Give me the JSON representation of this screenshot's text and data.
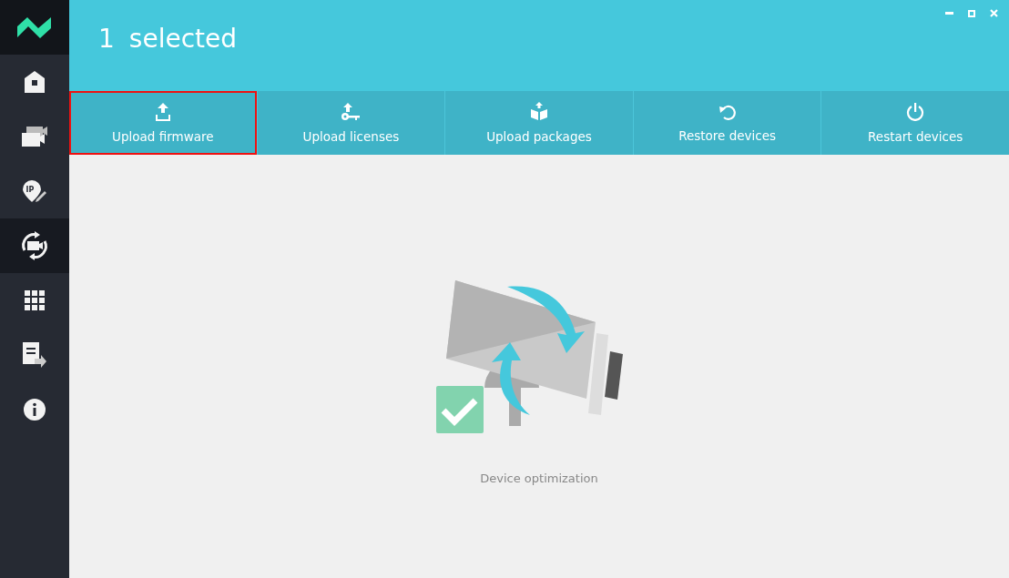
{
  "sidebar": {
    "items": [
      {
        "selected": false
      },
      {
        "selected": false
      },
      {
        "selected": false,
        "icon_text": "IP"
      },
      {
        "selected": true
      },
      {
        "selected": false
      },
      {
        "selected": false
      },
      {
        "selected": false
      }
    ]
  },
  "header": {
    "count": "1",
    "label": "selected"
  },
  "actions": [
    {
      "label": "Upload firmware",
      "selected": true
    },
    {
      "label": "Upload licenses",
      "selected": false
    },
    {
      "label": "Upload packages",
      "selected": false
    },
    {
      "label": "Restore devices",
      "selected": false
    },
    {
      "label": "Restart devices",
      "selected": false
    }
  ],
  "empty_state": {
    "caption": "Device optimization"
  }
}
